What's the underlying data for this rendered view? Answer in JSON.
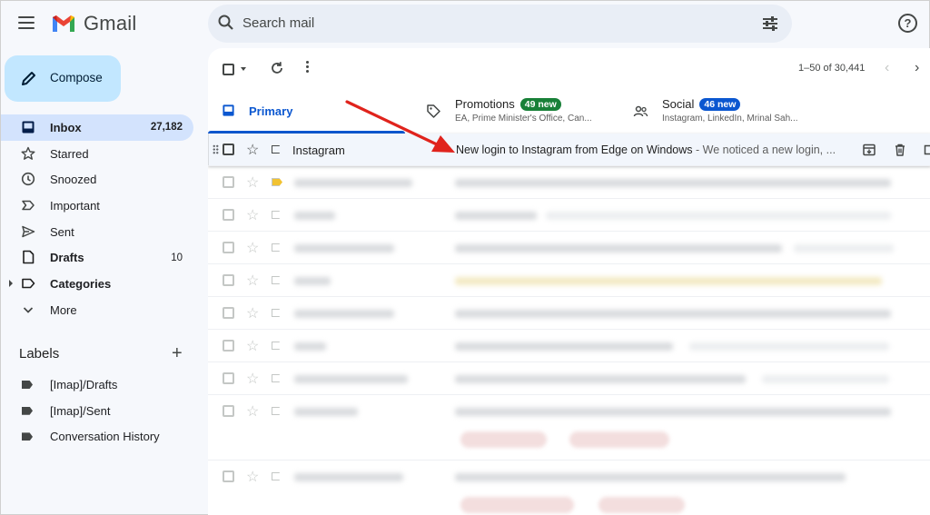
{
  "app": {
    "name": "Gmail"
  },
  "search": {
    "placeholder": "Search mail"
  },
  "help": {
    "glyph": "?"
  },
  "compose": {
    "label": "Compose"
  },
  "nav": [
    {
      "label": "Inbox",
      "count": "27,182",
      "icon": "inbox-icon",
      "active": true,
      "bold": true
    },
    {
      "label": "Starred",
      "count": "",
      "icon": "star-icon"
    },
    {
      "label": "Snoozed",
      "count": "",
      "icon": "clock-icon"
    },
    {
      "label": "Important",
      "count": "",
      "icon": "important-icon"
    },
    {
      "label": "Sent",
      "count": "",
      "icon": "send-icon"
    },
    {
      "label": "Drafts",
      "count": "10",
      "icon": "draft-icon",
      "bold": true
    },
    {
      "label": "Categories",
      "count": "",
      "icon": "label-outline-icon",
      "bold": true
    },
    {
      "label": "More",
      "count": "",
      "icon": "chevron-down-icon"
    }
  ],
  "labels": {
    "title": "Labels",
    "add": "+",
    "items": [
      "[Imap]/Drafts",
      "[Imap]/Sent",
      "Conversation History"
    ]
  },
  "toolbar": {
    "pagination": "1–50 of 30,441",
    "prev": "‹",
    "next": "›"
  },
  "tabs": {
    "primary": {
      "label": "Primary"
    },
    "promotions": {
      "label": "Promotions",
      "badge": "49 new",
      "badge_color": "#188038",
      "sub": "EA, Prime Minister's Office, Can..."
    },
    "social": {
      "label": "Social",
      "badge": "46 new",
      "badge_color": "#0b57d0",
      "sub": "Instagram, LinkedIn, Mrinal Sah..."
    }
  },
  "emails": [
    {
      "sender": "Instagram",
      "subject": "New login to Instagram from Edge on Windows",
      "snippet": " - We noticed a new login, ...",
      "star": "☆"
    }
  ],
  "blurred_row_star": "☆",
  "colors": {
    "accent": "#0b57d0",
    "compose_bg": "#c2e7ff",
    "active_nav": "#d3e3fd",
    "arrow": "#e0231c"
  }
}
